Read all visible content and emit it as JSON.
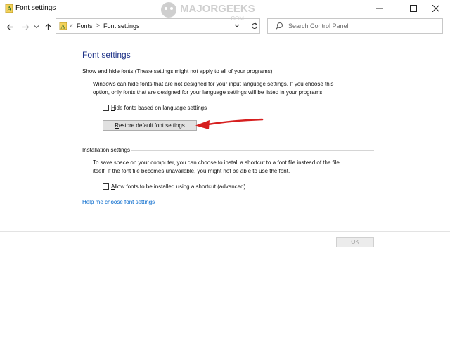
{
  "window": {
    "title": "Font settings",
    "watermark_main": "MAJORGEEKS",
    "watermark_sub": ".COM"
  },
  "navigation": {
    "breadcrumbs": [
      "Fonts",
      "Font settings"
    ],
    "breadcrumb_prefix": "«",
    "breadcrumb_separator": ">"
  },
  "search": {
    "placeholder": "Search Control Panel"
  },
  "main": {
    "heading": "Font settings",
    "show_hide": {
      "group_label": "Show and hide fonts (These settings might not apply to all of your programs)",
      "description_line1": "Windows can hide fonts that are not designed for your input language settings. If you choose this",
      "description_line2": "option, only fonts that are designed for your language settings will be listed in your programs.",
      "hide_checkbox_label_acc": "H",
      "hide_checkbox_label_rest": "ide fonts based on language settings",
      "hide_checked": false,
      "restore_button_acc": "R",
      "restore_button_rest": "estore default font settings"
    },
    "installation": {
      "group_label": "Installation settings",
      "description_line1": "To save space on your computer, you can choose to install a shortcut to a font file instead of the file",
      "description_line2": "itself. If the font file becomes unavailable, you might not be able to use the font.",
      "shortcut_checkbox_label_acc": "A",
      "shortcut_checkbox_label_rest": "llow fonts to be installed using a shortcut (advanced)",
      "shortcut_checked": false
    },
    "help_link": "Help me choose font settings"
  },
  "footer": {
    "ok_label": "OK"
  },
  "colors": {
    "heading": "#1e3287",
    "link": "#0066cc",
    "annotation_arrow": "#d61f1f"
  }
}
